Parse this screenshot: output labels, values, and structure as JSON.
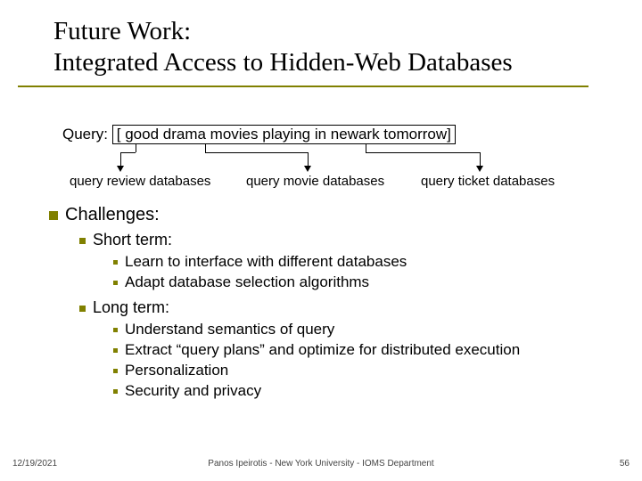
{
  "title_line1": "Future Work:",
  "title_line2": "Integrated Access to Hidden-Web Databases",
  "query_label": "Query:",
  "query_text": "[ good  drama movies playing in newark tomorrow]",
  "db_labels": {
    "review": "query review databases",
    "movie": "query movie databases",
    "ticket": "query ticket databases"
  },
  "challenges_heading": "Challenges:",
  "short_term_heading": "Short term:",
  "short_term_items": [
    "Learn to interface with different databases",
    "Adapt database selection algorithms"
  ],
  "long_term_heading": "Long term:",
  "long_term_items": [
    "Understand semantics of query",
    "Extract “query plans” and optimize for distributed execution",
    "Personalization",
    "Security and privacy"
  ],
  "footer": {
    "date": "12/19/2021",
    "center": "Panos Ipeirotis - New York University - IOMS Department",
    "page": "56"
  }
}
